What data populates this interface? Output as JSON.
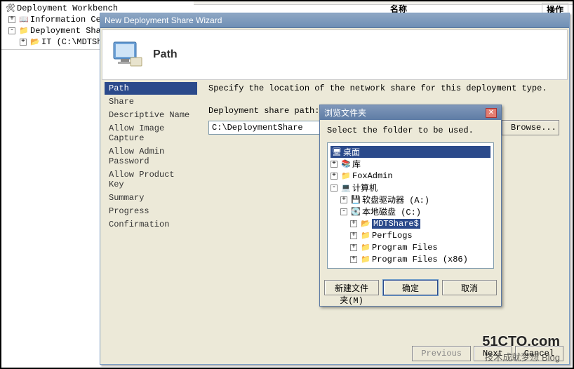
{
  "mmc": {
    "root": "Deployment Workbench",
    "info": "Information Center",
    "shares": "Deployment Shares",
    "share1": "IT (C:\\MDTShare",
    "col_name": "名称",
    "col_ops": "操作"
  },
  "wizard": {
    "title": "New Deployment Share Wizard",
    "heading": "Path",
    "steps": [
      "Path",
      "Share",
      "Descriptive Name",
      "Allow Image Capture",
      "Allow Admin Password",
      "Allow Product Key",
      "Summary",
      "Progress",
      "Confirmation"
    ],
    "instr": "Specify the location of the network share for this deployment type.",
    "path_label": "Deployment share path:",
    "path_value": "C:\\DeploymentShare",
    "browse_btn": "Browse...",
    "prev": "Previous",
    "next": "Next",
    "cancel": "Cancel"
  },
  "browse": {
    "title": "浏览文件夹",
    "msg": "Select the folder to be used.",
    "newfolder": "新建文件夹(M)",
    "ok": "确定",
    "cancel": "取消",
    "tree": {
      "desktop": "桌面",
      "lib": "库",
      "foxadmin": "FoxAdmin",
      "computer": "计算机",
      "floppy": "软盘驱动器 (A:)",
      "cdrive": "本地磁盘 (C:)",
      "mdt": "MDTShare$",
      "perflogs": "PerfLogs",
      "pf": "Program Files",
      "pf86": "Program Files (x86)"
    }
  },
  "watermark": {
    "l1": "51CTO.com",
    "l2": "技术成就梦想 Blog"
  }
}
